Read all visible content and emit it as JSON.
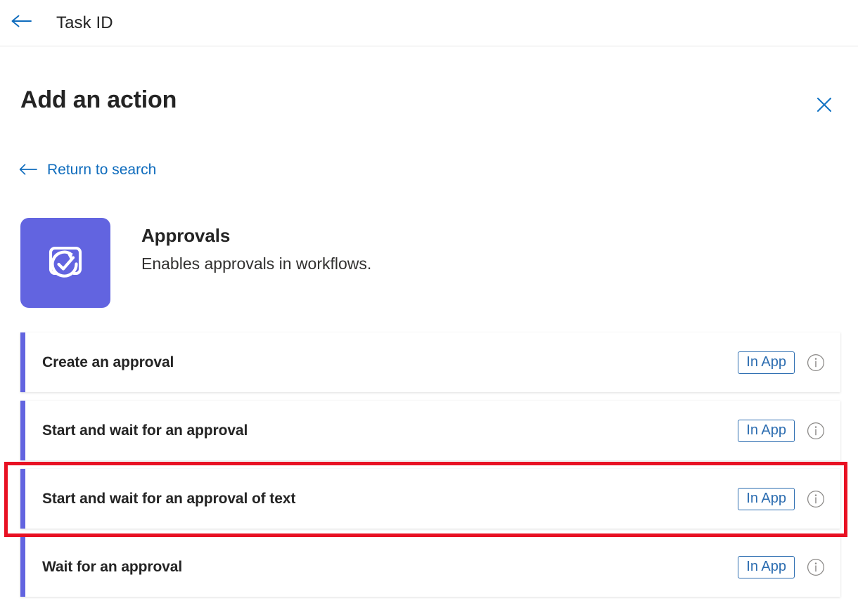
{
  "appbar": {
    "back_icon": "arrow-left-icon",
    "title": "Task ID"
  },
  "panel": {
    "title": "Add an action",
    "close_icon": "close-icon",
    "return_link": {
      "icon": "arrow-left-icon",
      "label": "Return to search"
    },
    "connector": {
      "icon": "approvals-icon",
      "icon_background": "#6264e0",
      "name": "Approvals",
      "description": "Enables approvals in workflows."
    },
    "actions": [
      {
        "label": "Create an approval",
        "badge": "In App",
        "info_icon": "info-icon",
        "accent_color": "#6264e0",
        "highlighted": false
      },
      {
        "label": "Start and wait for an approval",
        "badge": "In App",
        "info_icon": "info-icon",
        "accent_color": "#6264e0",
        "highlighted": false
      },
      {
        "label": "Start and wait for an approval of text",
        "badge": "In App",
        "info_icon": "info-icon",
        "accent_color": "#6264e0",
        "highlighted": true
      },
      {
        "label": "Wait for an approval",
        "badge": "In App",
        "info_icon": "info-icon",
        "accent_color": "#6264e0",
        "highlighted": false
      }
    ]
  },
  "colors": {
    "accent_blue": "#0f6cbd",
    "badge_blue": "#2b6cb0",
    "connector_purple": "#6264e0",
    "highlight_red": "#e81123",
    "text_dark": "#242424"
  }
}
